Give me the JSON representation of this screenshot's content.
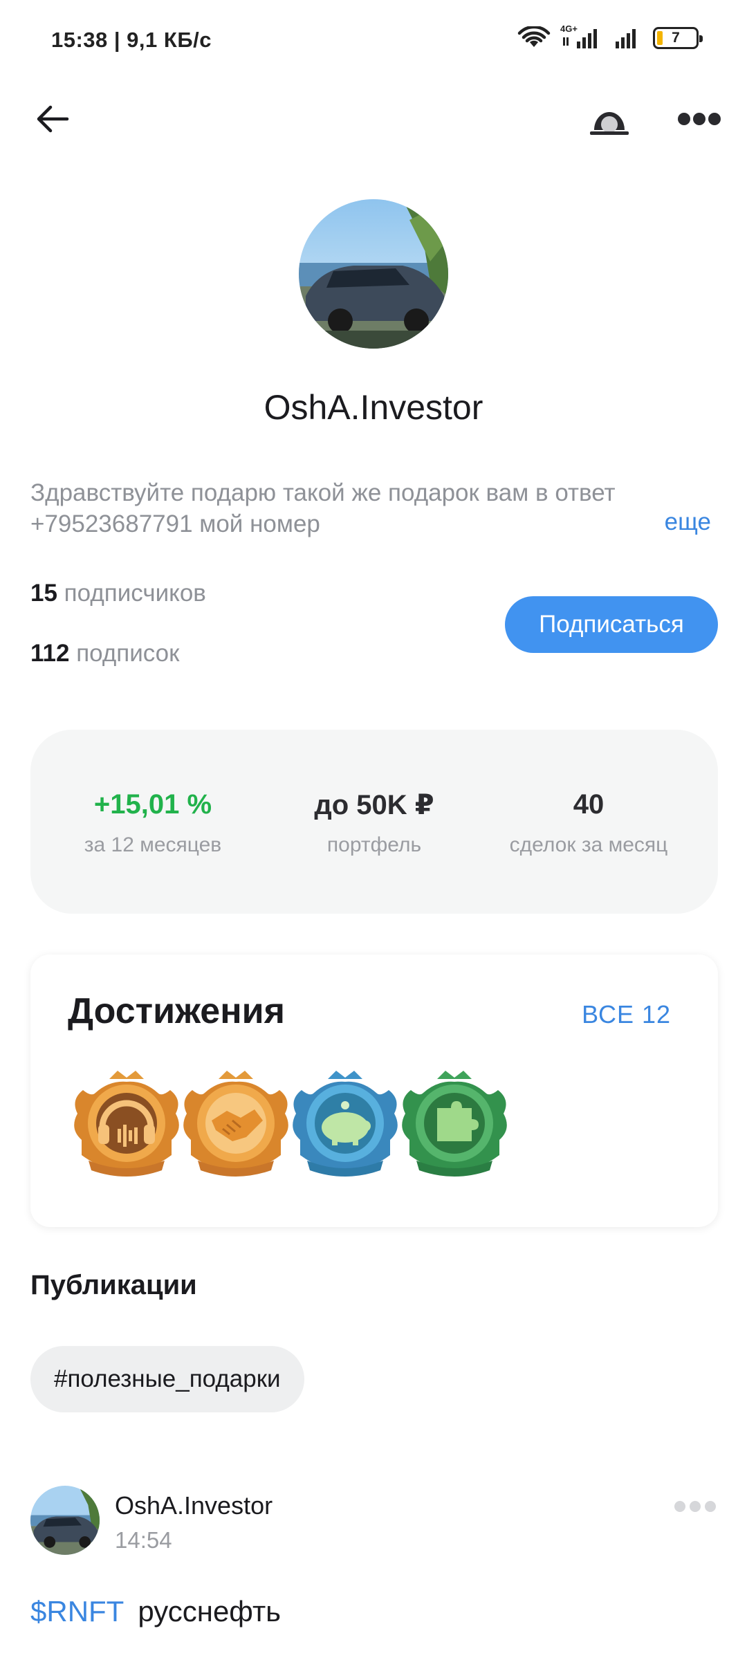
{
  "status_bar": {
    "time": "15:38 | 9,1 КБ/с",
    "network_type": "4G+",
    "battery_level": "7"
  },
  "app_bar": {
    "back_icon": "arrow-left-icon",
    "incognito_icon": "incognito-icon",
    "more_icon": "more-dots-icon"
  },
  "profile": {
    "name": "OshA.Investor",
    "bio": "Здравствуйте подарю такой же подарок  вам в ответ +79523687791 мой номер",
    "bio_more": "еще",
    "followers_count": "15",
    "followers_label": "подписчиков",
    "following_count": "112",
    "following_label": "подписок",
    "subscribe_label": "Подписаться"
  },
  "stats": [
    {
      "value": "+15,01 %",
      "label": "за 12 месяцев",
      "color": "#21b24b"
    },
    {
      "value": "до 50K ₽",
      "label": "портфель"
    },
    {
      "value": "40",
      "label": "сделок за месяц"
    }
  ],
  "achievements": {
    "title": "Достижения",
    "all_label": "ВСЕ 12",
    "badges": [
      {
        "icon": "headphones-badge-icon",
        "color": "#e39a3a"
      },
      {
        "icon": "handshake-badge-icon",
        "color": "#e39a3a"
      },
      {
        "icon": "piggy-bank-badge-icon",
        "color": "#4a9ccf"
      },
      {
        "icon": "puzzle-badge-icon",
        "color": "#3fa35a"
      }
    ]
  },
  "publications": {
    "title": "Публикации",
    "tag": "#полезные_подарки"
  },
  "post": {
    "author": "OshA.Investor",
    "time": "14:54",
    "ticker": "$RNFT",
    "text": "русснефть"
  }
}
